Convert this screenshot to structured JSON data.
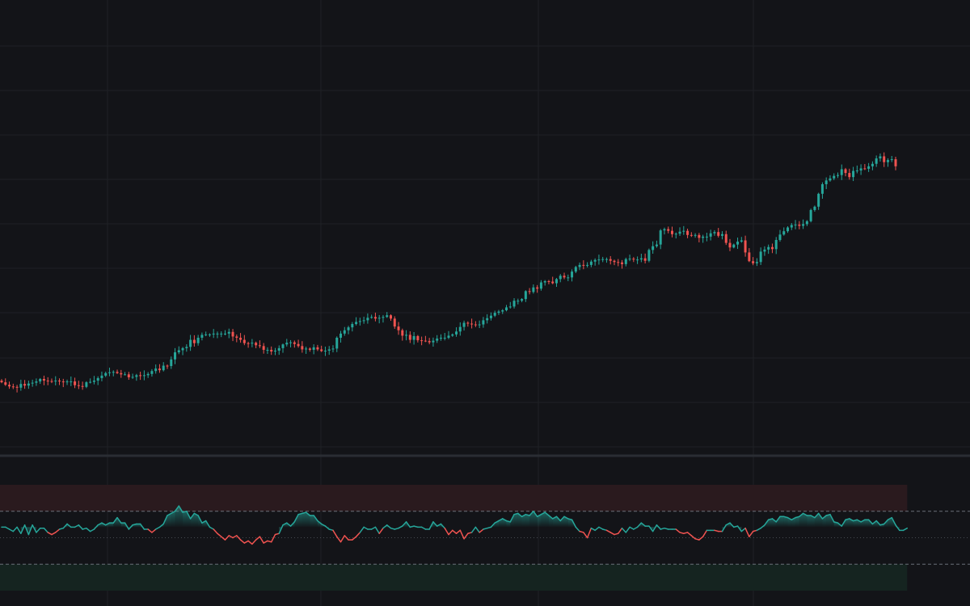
{
  "colors": {
    "background": "#131418",
    "grid": "#1f2126",
    "up": "#26a69a",
    "down": "#ef5350",
    "separator": "#2a2d33",
    "overbought_zone": "#2a1a1e",
    "oversold_zone": "#152420",
    "dashed_level": "#6b6f78"
  },
  "chart_data": [
    {
      "type": "candlestick",
      "ylim": [
        0,
        100
      ],
      "grid": true,
      "count": 233,
      "closes": [
        15.9,
        15.3,
        14.9,
        14.8,
        14.6,
        15.5,
        15.1,
        15.6,
        15.8,
        16.1,
        16.7,
        16.3,
        16.2,
        16.1,
        16.3,
        16.1,
        15.9,
        16.1,
        16.1,
        15.2,
        15.0,
        14.8,
        15.9,
        16.0,
        16.3,
        16.9,
        17.5,
        18.1,
        18.3,
        18.4,
        18.1,
        17.8,
        17.8,
        17.1,
        17.2,
        17.6,
        17.4,
        17.6,
        17.9,
        18.6,
        19.2,
        18.8,
        19.9,
        19.8,
        21.4,
        23.1,
        23.6,
        24.1,
        24.4,
        26.1,
        25.3,
        26.6,
        27.3,
        27.4,
        27.4,
        27.6,
        27.6,
        27.6,
        27.6,
        28.0,
        26.9,
        26.6,
        26.1,
        25.3,
        25.2,
        25.4,
        24.8,
        24.6,
        23.7,
        23.7,
        23.3,
        23.5,
        24.1,
        25.0,
        25.4,
        25.5,
        25.1,
        24.6,
        23.8,
        24.0,
        23.7,
        24.3,
        23.8,
        23.4,
        23.5,
        23.8,
        24.0,
        26.6,
        27.6,
        28.4,
        29.1,
        29.9,
        30.4,
        30.6,
        30.8,
        31.4,
        31.6,
        31.2,
        31.4,
        31.6,
        32.0,
        31.2,
        29.3,
        28.4,
        27.1,
        27.3,
        26.1,
        27.0,
        26.0,
        25.9,
        25.8,
        25.5,
        25.9,
        26.4,
        26.6,
        26.6,
        27.1,
        27.4,
        28.1,
        29.2,
        30.2,
        30.0,
        29.8,
        29.7,
        29.8,
        30.8,
        31.3,
        31.9,
        32.6,
        32.9,
        33.2,
        33.9,
        34.1,
        35.5,
        35.5,
        35.9,
        37.8,
        37.6,
        38.7,
        38.4,
        39.9,
        40.2,
        40.1,
        39.7,
        40.7,
        41.5,
        41.1,
        41.1,
        42.5,
        43.6,
        44.1,
        43.9,
        44.1,
        44.9,
        45.3,
        45.4,
        45.5,
        45.5,
        45.1,
        44.8,
        44.7,
        44.3,
        45.5,
        45.6,
        45.4,
        45.4,
        45.7,
        45.1,
        47.7,
        48.6,
        49.0,
        52.4,
        52.7,
        52.3,
        51.5,
        51.6,
        52.1,
        52.3,
        51.3,
        51.2,
        51.3,
        50.6,
        50.9,
        50.9,
        51.7,
        52.0,
        51.1,
        51.5,
        49.4,
        48.3,
        49.0,
        49.7,
        50.0,
        47.1,
        45.0,
        44.5,
        44.8,
        47.3,
        47.8,
        48.4,
        47.9,
        50.1,
        51.4,
        52.2,
        53.1,
        53.7,
        53.8,
        53.5,
        53.9,
        54.6,
        57.3,
        58.1,
        61.2,
        63.5,
        64.4,
        64.9,
        65.5,
        65.7,
        67.1,
        66.2,
        65.2,
        66.7,
        66.8,
        67.3,
        67.2,
        67.8,
        68.4,
        69.7,
        70.2,
        68.8,
        69.3,
        69.5,
        67.8
      ]
    },
    {
      "type": "line",
      "levels": [
        "overbought",
        "mid",
        "oversold"
      ],
      "values": [
        60,
        60,
        58,
        56,
        60,
        54,
        62,
        53,
        62,
        55,
        59,
        59,
        55,
        53,
        55,
        58,
        59,
        63,
        60,
        60,
        62,
        58,
        59,
        56,
        58,
        62,
        64,
        62,
        64,
        64,
        69,
        64,
        64,
        58,
        62,
        63,
        63,
        58,
        58,
        55,
        58,
        60,
        63,
        71,
        73,
        75,
        80,
        74,
        75,
        68,
        73,
        71,
        64,
        66,
        60,
        58,
        54,
        51,
        48,
        52,
        50,
        52,
        48,
        45,
        47,
        44,
        48,
        51,
        45,
        47,
        46,
        53,
        54,
        62,
        64,
        61,
        65,
        72,
        73,
        74,
        71,
        71,
        66,
        63,
        61,
        58,
        57,
        51,
        46,
        52,
        48,
        48,
        51,
        55,
        60,
        58,
        58,
        60,
        54,
        59,
        62,
        59,
        58,
        59,
        61,
        65,
        60,
        61,
        60,
        60,
        58,
        58,
        65,
        61,
        63,
        59,
        53,
        57,
        54,
        57,
        49,
        54,
        55,
        60,
        55,
        58,
        59,
        60,
        64,
        66,
        68,
        66,
        65,
        72,
        73,
        70,
        72,
        71,
        75,
        70,
        72,
        74,
        71,
        68,
        70,
        66,
        70,
        68,
        67,
        60,
        56,
        55,
        50,
        59,
        57,
        60,
        58,
        57,
        55,
        53,
        54,
        59,
        55,
        60,
        58,
        60,
        64,
        61,
        61,
        56,
        62,
        58,
        59,
        58,
        58,
        58,
        55,
        54,
        55,
        52,
        49,
        48,
        51,
        57,
        57,
        57,
        56,
        56,
        62,
        64,
        60,
        61,
        56,
        59,
        51,
        56,
        57,
        59,
        62,
        67,
        68,
        65,
        70,
        70,
        69,
        67,
        69,
        70,
        73,
        71,
        71,
        69,
        73,
        68,
        71,
        72,
        65,
        64,
        61,
        67,
        68,
        66,
        67,
        65,
        67,
        67,
        63,
        66,
        62,
        63,
        67,
        69,
        62,
        57,
        57,
        59
      ]
    }
  ]
}
